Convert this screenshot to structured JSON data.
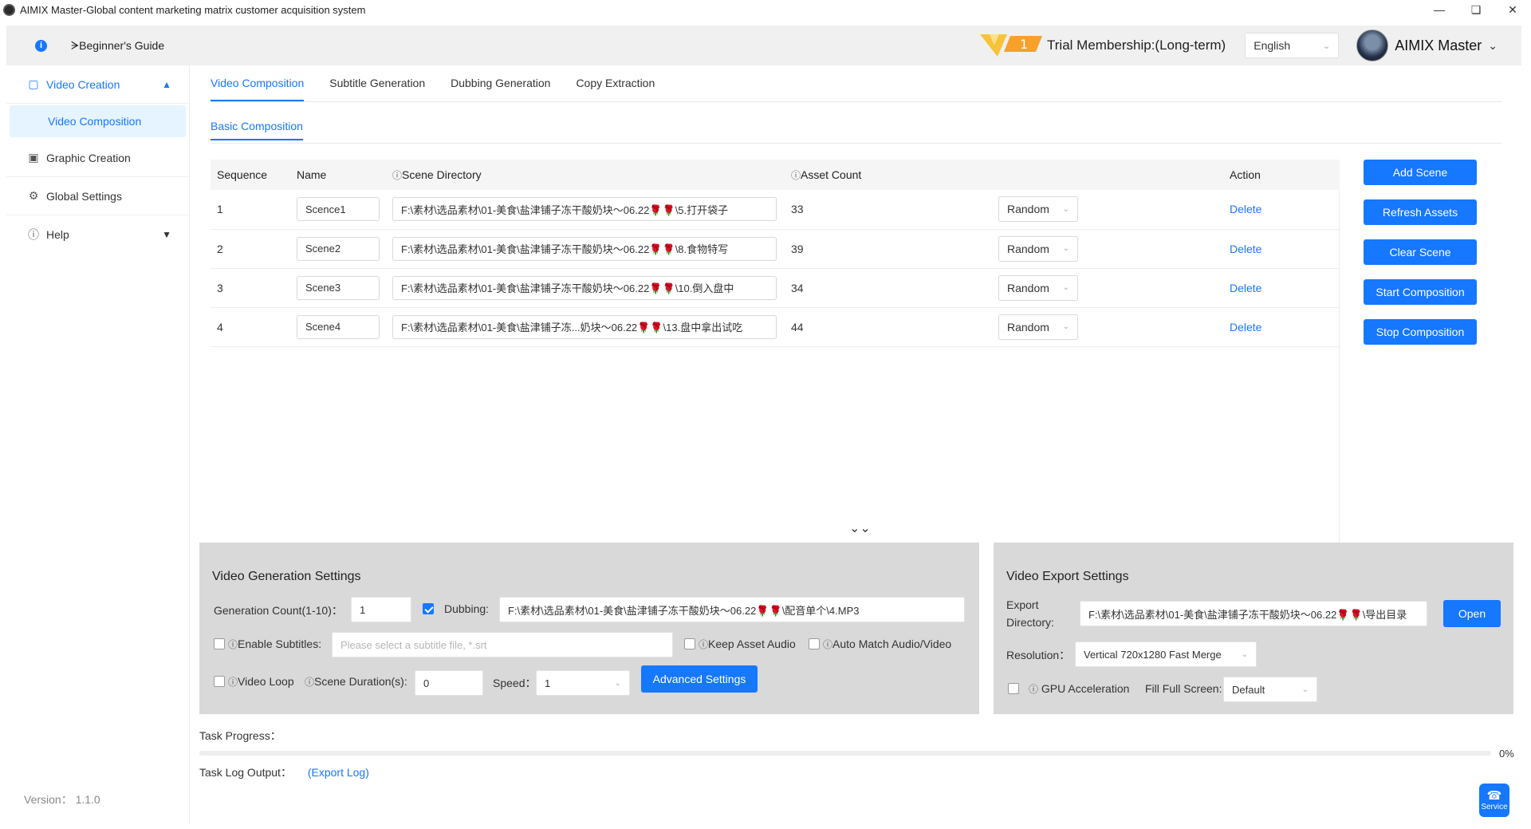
{
  "window": {
    "title": "AIMIX Master-Global content marketing matrix customer acquisition system"
  },
  "header": {
    "guide": "ᗒBeginner's Guide",
    "badge_number": "1",
    "membership": "Trial Membership:(Long-term)",
    "language": "English",
    "user_name": "AIMIX Master"
  },
  "sidebar": {
    "items": [
      {
        "label": "Video Creation",
        "icon": "video-icon"
      },
      {
        "label": "Video Composition"
      },
      {
        "label": "Graphic Creation",
        "icon": "image-icon"
      },
      {
        "label": "Global Settings",
        "icon": "gear-icon"
      },
      {
        "label": "Help",
        "icon": "help-icon"
      }
    ],
    "version": "Version： 1.1.0"
  },
  "tabs": [
    "Video Composition",
    "Subtitle Generation",
    "Dubbing Generation",
    "Copy Extraction"
  ],
  "subtabs": [
    "Basic Composition"
  ],
  "table": {
    "headers": {
      "sequence": "Sequence",
      "name": "Name",
      "dir": "Scene Directory",
      "count": "Asset Count",
      "action": "Action"
    },
    "rows": [
      {
        "seq": "1",
        "name": "Scence1",
        "dir": "F:\\素材\\选品素材\\01-美食\\盐津铺子冻干酸奶块～06.22🌹🌹\\5.打开袋子",
        "count": "33",
        "mode": "Random",
        "action": "Delete"
      },
      {
        "seq": "2",
        "name": "Scene2",
        "dir": "F:\\素材\\选品素材\\01-美食\\盐津铺子冻干酸奶块～06.22🌹🌹\\8.食物特写",
        "count": "39",
        "mode": "Random",
        "action": "Delete"
      },
      {
        "seq": "3",
        "name": "Scene3",
        "dir": "F:\\素材\\选品素材\\01-美食\\盐津铺子冻干酸奶块～06.22🌹🌹\\10.倒入盘中",
        "count": "34",
        "mode": "Random",
        "action": "Delete"
      },
      {
        "seq": "4",
        "name": "Scene4",
        "dir": "F:\\素材\\选品素材\\01-美食\\盐津铺子冻...奶块～06.22🌹🌹\\13.盘中拿出试吃",
        "count": "44",
        "mode": "Random",
        "action": "Delete"
      }
    ]
  },
  "actions": {
    "add_scene": "Add Scene",
    "refresh_assets": "Refresh Assets",
    "clear_scene": "Clear Scene",
    "start": "Start Composition",
    "stop": "Stop Composition"
  },
  "gen_settings": {
    "title": "Video Generation Settings",
    "count_label": "Generation Count(1-10)：",
    "count_value": "1",
    "dubbing_label": "Dubbing:",
    "dubbing_checked": true,
    "dubbing_path": "F:\\素材\\选品素材\\01-美食\\盐津铺子冻干酸奶块～06.22🌹🌹\\配音单个\\4.MP3",
    "subtitles_label": "Enable Subtitles:",
    "subtitles_placeholder": "Please select a subtitle file, *.srt",
    "keep_audio_label": "Keep Asset Audio",
    "auto_match_label": "Auto Match Audio/Video",
    "loop_label": "Video Loop",
    "duration_label": "Scene Duration(s):",
    "duration_value": "0",
    "speed_label": "Speed：",
    "speed_value": "1",
    "advanced": "Advanced Settings"
  },
  "export_settings": {
    "title": "Video Export Settings",
    "dir_label_1": "Export",
    "dir_label_2": "Directory:",
    "dir_value": "F:\\素材\\选品素材\\01-美食\\盐津铺子冻干酸奶块～06.22🌹🌹\\导出目录",
    "open": "Open",
    "resolution_label": "Resolution：",
    "resolution_value": "Vertical 720x1280 Fast Merge",
    "gpu_label": "GPU Acceleration",
    "fill_label": "Fill Full Screen:",
    "fill_value": "Default"
  },
  "progress": {
    "label": "Task Progress：",
    "percent_text": "0%",
    "value": 0
  },
  "log": {
    "label": "Task Log Output：",
    "export": "(Export Log)"
  },
  "service": {
    "label": "Service"
  },
  "colors": {
    "accent": "#1677ff",
    "panel": "#d9d9d9",
    "badge": "#f7a12b"
  }
}
